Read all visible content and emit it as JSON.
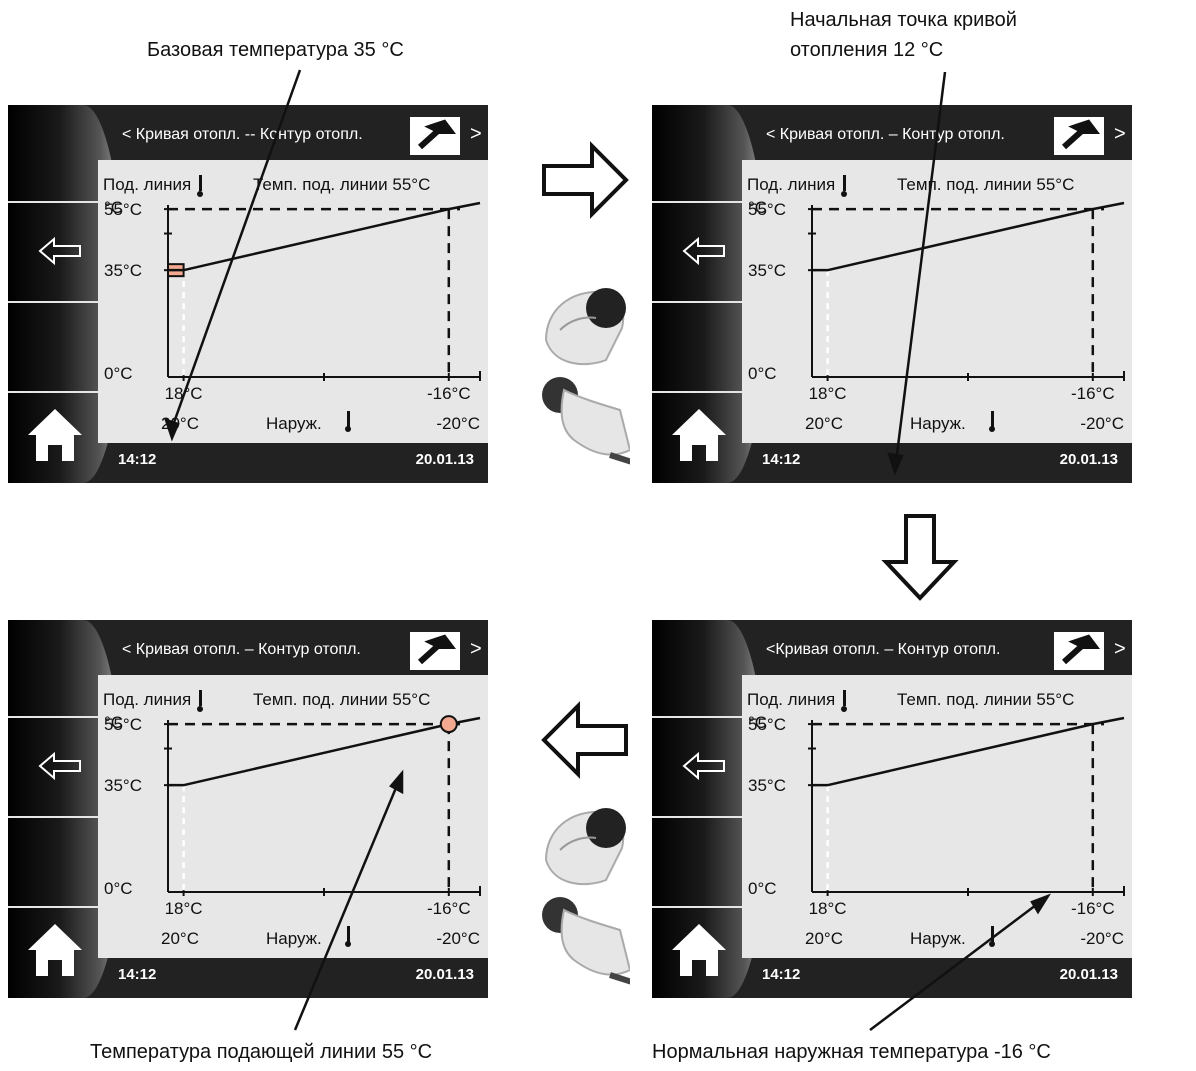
{
  "captions": {
    "top_left": "Базовая температура 35 °C",
    "top_right_line1": "Начальная точка кривой",
    "top_right_line2": "отопления 12 °C",
    "bottom_left": "Температура подающей линии 55 °C",
    "bottom_right": "Нормальная наружная температура -16 °C"
  },
  "screen": {
    "title": "Кривая отопл. – Контур отопл.",
    "title_variant_top_left": "Кривая отопл. -- Контур отопл.",
    "title_variant_bottom_right": "Кривая отопл. – Контур отопл.",
    "back_chevron": "<",
    "next_chevron": ">",
    "time": "14:12",
    "date": "20.01.13",
    "y_label": "Под. линия",
    "y_unit": "°C",
    "flow_temp_label": "Темп. под. линии 55°C",
    "y_tick_55": "55°C",
    "y_tick_35": "35°C",
    "y_tick_0": "0°C",
    "x_tick_18": "18°C",
    "x_tick_m16": "-16°C",
    "x_left": "20°C",
    "x_right": "-20°C",
    "x_label": "Наруж."
  },
  "colors": {
    "highlight": "#f2a98f",
    "panel_bg": "#222222",
    "screen_bg": "#e7e7e7"
  },
  "chart_data": {
    "type": "line",
    "x_unit": "°C outdoor",
    "y_unit": "°C flow",
    "points": [
      {
        "x": 20,
        "y": 35
      },
      {
        "x": 18,
        "y": 35
      },
      {
        "x": -16,
        "y": 55
      },
      {
        "x": -20,
        "y": 57
      }
    ],
    "reference_lines": {
      "y": 55,
      "x": -16
    }
  }
}
